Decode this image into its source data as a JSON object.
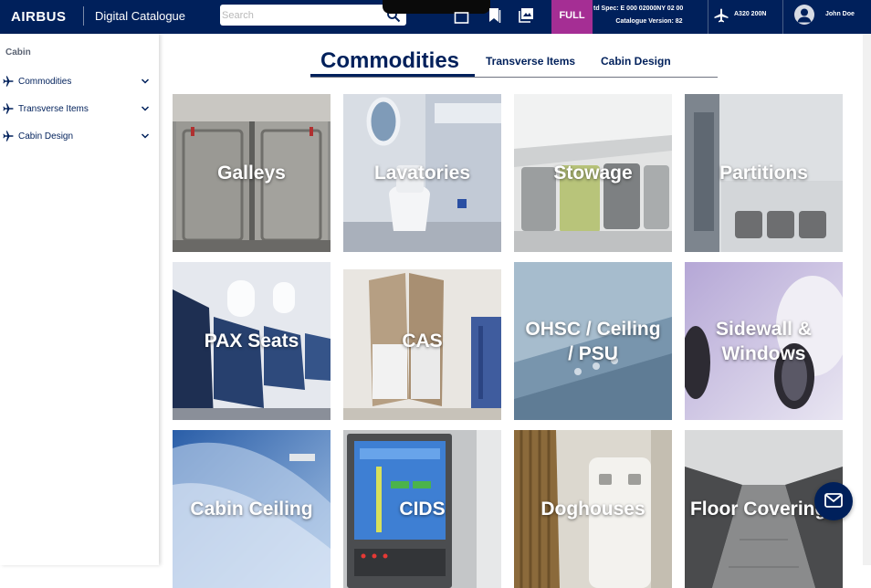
{
  "header": {
    "brand": "AIRBUS",
    "app_title": "Digital Catalogue",
    "search_placeholder": "Search",
    "full_badge": "FULL",
    "spec_line1": "td Spec: E 000 02000NY 02 00",
    "spec_line2": "Catalogue Version: 82",
    "aircraft": "A320 200N",
    "user_name": "John Doe"
  },
  "sidebar": {
    "heading": "Cabin",
    "items": [
      {
        "label": "Commodities",
        "icon": "plane-icon"
      },
      {
        "label": "Transverse Items",
        "icon": "plane-icon"
      },
      {
        "label": "Cabin Design",
        "icon": "plane-icon"
      }
    ]
  },
  "tabs": [
    {
      "label": "Commodities",
      "active": true
    },
    {
      "label": "Transverse Items",
      "active": false
    },
    {
      "label": "Cabin Design",
      "active": false
    }
  ],
  "tiles": [
    {
      "label": "Galleys"
    },
    {
      "label": "Lavatories"
    },
    {
      "label": "Stowage"
    },
    {
      "label": "Partitions"
    },
    {
      "label": "PAX Seats"
    },
    {
      "label": "CAS"
    },
    {
      "label": "OHSC / Ceiling\n/ PSU"
    },
    {
      "label": "Sidewall &\nWindows"
    },
    {
      "label": "Cabin Ceiling"
    },
    {
      "label": "CIDS"
    },
    {
      "label": "Doghouses"
    },
    {
      "label": "Floor Coverings"
    }
  ],
  "colors": {
    "header_bg": "#00205b",
    "accent_full": "#a52e94",
    "link": "#00205b"
  },
  "icons": [
    "search-icon",
    "document-icon",
    "bookmark-icon",
    "gallery-icon",
    "plane-icon",
    "avatar-icon",
    "chevron-down-icon",
    "mail-icon"
  ]
}
